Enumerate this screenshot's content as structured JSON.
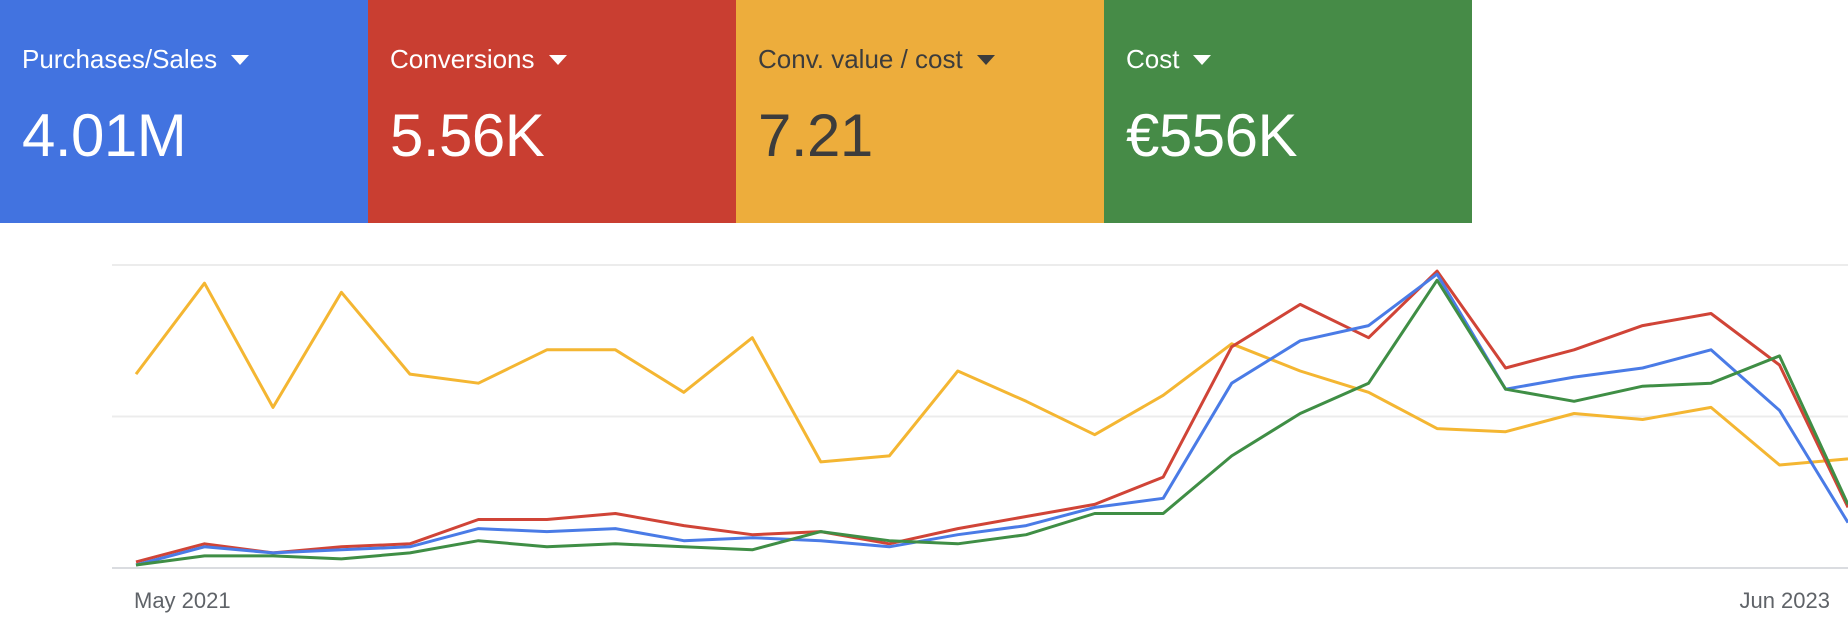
{
  "cards": [
    {
      "label": "Purchases/Sales",
      "value": "4.01M",
      "bg": "#4273E0",
      "fg": "#ffffff"
    },
    {
      "label": "Conversions",
      "value": "5.56K",
      "bg": "#C93E31",
      "fg": "#ffffff"
    },
    {
      "label": "Conv. value / cost",
      "value": "7.21",
      "bg": "#EDAD3C",
      "fg": "#3c3c3c"
    },
    {
      "label": "Cost",
      "value": "€556K",
      "bg": "#468B47",
      "fg": "#ffffff"
    }
  ],
  "chart_data": {
    "type": "line",
    "title": "",
    "xlabel": "",
    "ylabel": "",
    "x_tick_labels": [
      "May 2021",
      "Jun 2023"
    ],
    "ylim": [
      0,
      100
    ],
    "grid": true,
    "legend": "none",
    "series": [
      {
        "color": "#F4B632",
        "values": [
          64,
          94,
          53,
          91,
          64,
          61,
          72,
          72,
          58,
          76,
          35,
          37,
          65,
          55,
          44,
          57,
          74,
          65,
          58,
          46,
          45,
          51,
          49,
          53,
          34,
          36
        ]
      },
      {
        "color": "#D04437",
        "values": [
          2,
          8,
          5,
          7,
          8,
          16,
          16,
          18,
          14,
          11,
          12,
          8,
          13,
          17,
          21,
          30,
          73,
          87,
          76,
          98,
          66,
          72,
          80,
          84,
          67,
          20
        ]
      },
      {
        "color": "#4A7BE6",
        "values": [
          1,
          7,
          5,
          6,
          7,
          13,
          12,
          13,
          9,
          10,
          9,
          7,
          11,
          14,
          20,
          23,
          61,
          75,
          80,
          97,
          59,
          63,
          66,
          72,
          52,
          15
        ]
      },
      {
        "color": "#3F8E45",
        "values": [
          1,
          4,
          4,
          3,
          5,
          9,
          7,
          8,
          7,
          6,
          12,
          9,
          8,
          11,
          18,
          18,
          37,
          51,
          61,
          95,
          59,
          55,
          60,
          61,
          70,
          21
        ]
      }
    ]
  }
}
